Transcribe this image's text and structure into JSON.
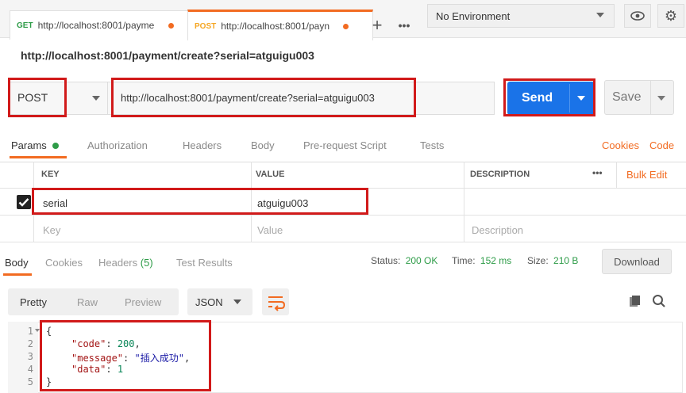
{
  "tabs": [
    {
      "method": "GET",
      "url": "http://localhost:8001/payme"
    },
    {
      "method": "POST",
      "url": "http://localhost:8001/payn"
    }
  ],
  "environment": {
    "selected": "No Environment"
  },
  "request": {
    "title": "http://localhost:8001/payment/create?serial=atguigu003",
    "method": "POST",
    "url": "http://localhost:8001/payment/create?serial=atguigu003",
    "send_label": "Send",
    "save_label": "Save"
  },
  "request_tabs": {
    "params": "Params",
    "authorization": "Authorization",
    "headers": "Headers",
    "body": "Body",
    "prerequest": "Pre-request Script",
    "tests": "Tests",
    "cookies": "Cookies",
    "code": "Code"
  },
  "params_table": {
    "headers": {
      "key": "KEY",
      "value": "VALUE",
      "description": "DESCRIPTION",
      "more": "•••",
      "bulk_edit": "Bulk Edit"
    },
    "rows": [
      {
        "key": "serial",
        "value": "atguigu003",
        "checked": true
      }
    ],
    "placeholders": {
      "key": "Key",
      "value": "Value",
      "description": "Description"
    }
  },
  "response_tabs": {
    "body": "Body",
    "cookies": "Cookies",
    "headers": "Headers",
    "headers_count": "(5)",
    "test_results": "Test Results"
  },
  "response_status": {
    "status_label": "Status:",
    "status_value": "200 OK",
    "time_label": "Time:",
    "time_value": "152 ms",
    "size_label": "Size:",
    "size_value": "210 B",
    "download": "Download"
  },
  "format_toolbar": {
    "pretty": "Pretty",
    "raw": "Raw",
    "preview": "Preview",
    "format": "JSON"
  },
  "response_body": {
    "line_numbers": [
      "1",
      "2",
      "3",
      "4",
      "5"
    ],
    "open": "{",
    "code_key": "\"code\"",
    "code_value": "200",
    "message_key": "\"message\"",
    "message_value": "\"插入成功\"",
    "data_key": "\"data\"",
    "data_value": "1",
    "close": "}"
  },
  "colors": {
    "accent": "#f26b21",
    "send": "#1a73e8",
    "status_ok": "#2e9c48",
    "annotation": "#d11a1a"
  }
}
